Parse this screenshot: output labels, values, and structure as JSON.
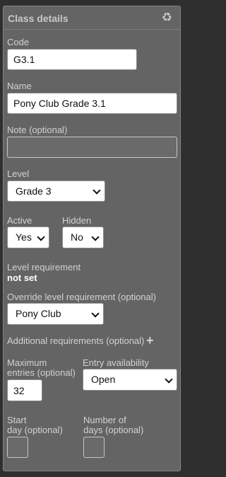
{
  "header": {
    "title": "Class details",
    "recycle_icon": "recycle-icon"
  },
  "code": {
    "label": "Code",
    "value": "G3.1"
  },
  "name": {
    "label": "Name",
    "value": "Pony Club Grade 3.1"
  },
  "note": {
    "label": "Note (optional)",
    "value": ""
  },
  "level": {
    "label": "Level",
    "value": "Grade 3"
  },
  "active": {
    "label": "Active",
    "value": "Yes"
  },
  "hidden": {
    "label": "Hidden",
    "value": "No"
  },
  "level_requirement": {
    "label": "Level requirement",
    "value": "not set"
  },
  "override": {
    "label": "Override level requirement (optional)",
    "value": "Pony Club"
  },
  "additional": {
    "label": "Additional requirements (optional)",
    "add_icon": "plus-icon"
  },
  "max_entries": {
    "label_line1": "Maximum",
    "label_line2": "entries (optional)",
    "value": "32"
  },
  "entry_availability": {
    "label": "Entry availability",
    "value": "Open"
  },
  "start_day": {
    "label_line1": "Start",
    "label_line2": "day (optional)",
    "value": ""
  },
  "num_days": {
    "label_line1": "Number of",
    "label_line2": "days (optional)",
    "value": ""
  }
}
